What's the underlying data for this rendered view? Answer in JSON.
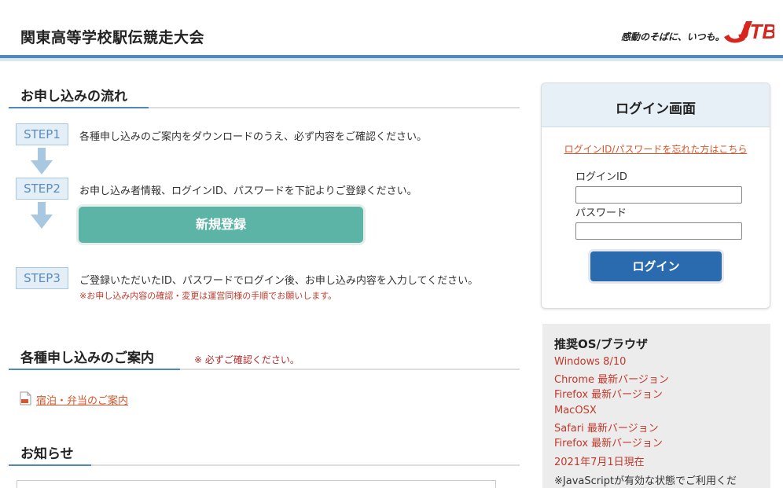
{
  "header": {
    "site_title": "関東高等学校駅伝競走大会",
    "tagline": "感動のそばに、いつも。",
    "logo_text": "JTB"
  },
  "flow": {
    "title": "お申し込みの流れ",
    "steps": [
      {
        "label": "STEP1",
        "text": "各種申し込みのご案内をダウンロードのうえ、必ず内容をご確認ください。"
      },
      {
        "label": "STEP2",
        "text": "お申し込み者情報、ログインID、パスワードを下記よりご登録ください。"
      },
      {
        "label": "STEP3",
        "text": "ご登録いただいたID、パスワードでログイン後、お申し込み内容を入力してください。",
        "note": "※お申し込み内容の確認・変更は運営同様の手順でお願いします。"
      }
    ],
    "register_button": "新規登録"
  },
  "guide": {
    "title": "各種申し込みのご案内",
    "note": "※ 必ずご確認ください。",
    "link": "宿泊・弁当のご案内"
  },
  "news": {
    "title": "お知らせ"
  },
  "login": {
    "title": "ログイン画面",
    "forgot_link": "ログインID/パスワードを忘れた方はこちら",
    "id_label": "ログインID",
    "id_value": "",
    "password_label": "パスワード",
    "password_value": "",
    "button": "ログイン"
  },
  "os": {
    "title": "推奨OS/ブラウザ",
    "windows": "Windows 8/10",
    "win_chrome": "Chrome 最新バージョン",
    "win_firefox": "Firefox 最新バージョン",
    "mac": "MacOSX",
    "mac_safari": "Safari 最新バージョン",
    "mac_firefox": "Firefox 最新バージョン",
    "as_of": "2021年7月1日現在",
    "js_note": "※JavaScriptが有効な状態でご利用くだ"
  },
  "colors": {
    "accent_blue": "#4f88ba",
    "register_green": "#5cb4a6",
    "login_blue": "#2a6aae",
    "link_orange": "#d9552b",
    "note_red": "#c0392b"
  }
}
